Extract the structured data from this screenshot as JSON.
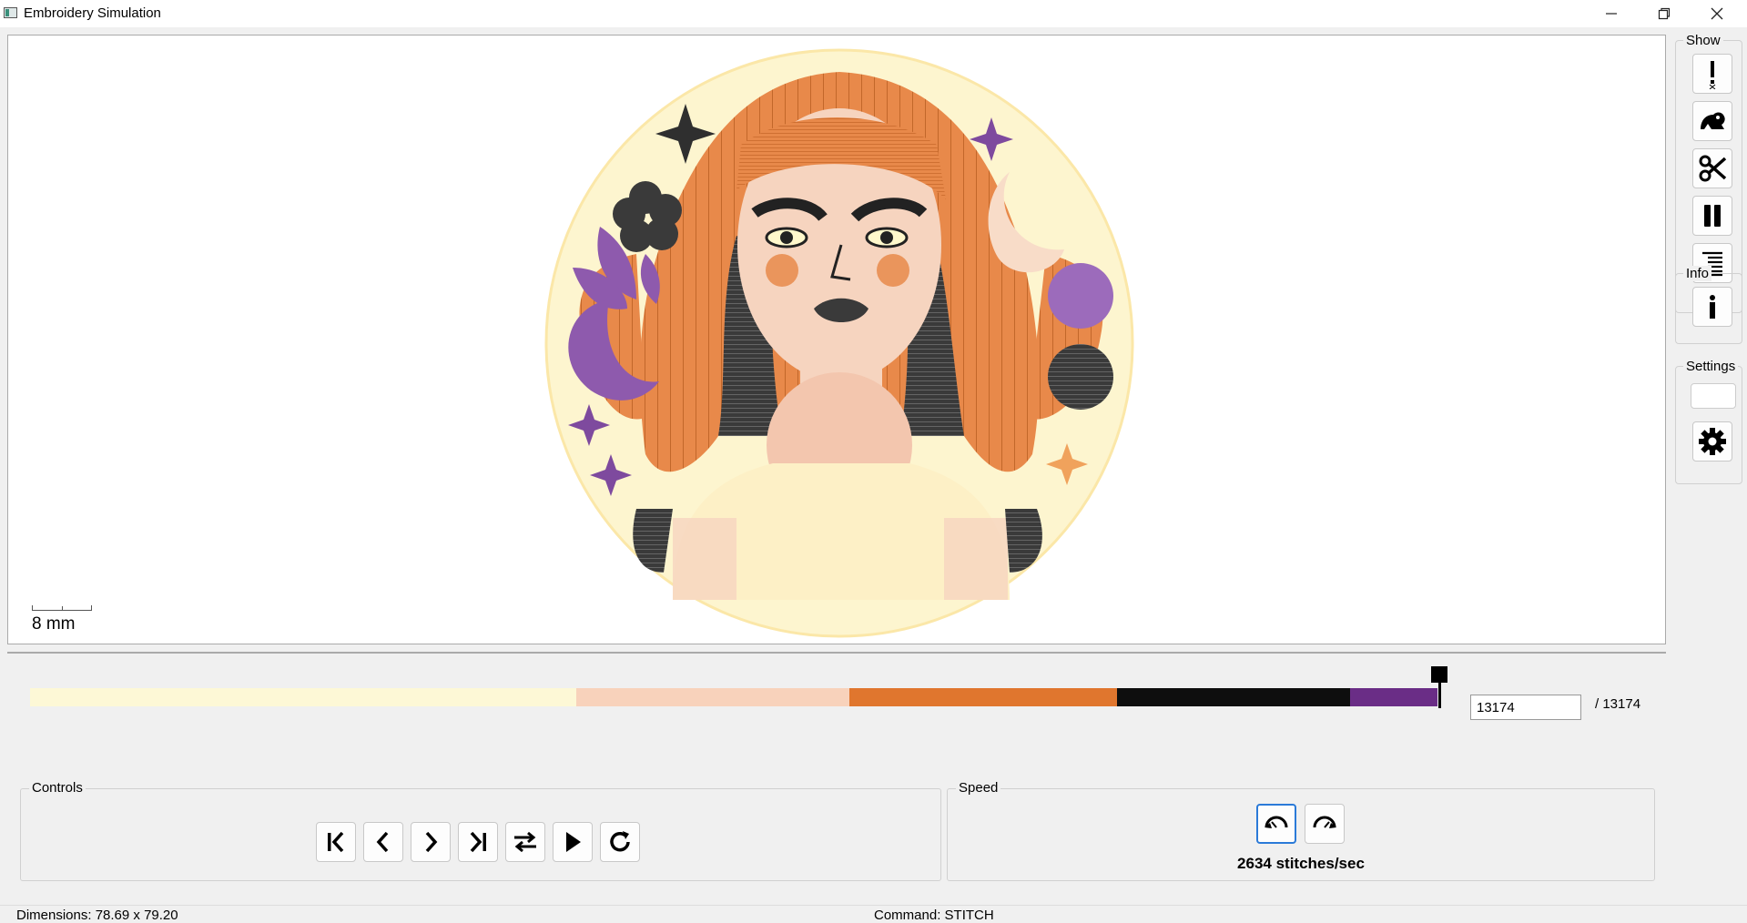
{
  "window": {
    "title": "Embroidery Simulation"
  },
  "canvas": {
    "scale_label": "8 mm"
  },
  "side_panel": {
    "show_title": "Show",
    "info_title": "Info",
    "settings_title": "Settings",
    "show_buttons": [
      "warning-icon",
      "frog-icon",
      "scissors-icon",
      "pause-icon",
      "text-lines-icon"
    ],
    "info_button": "info-icon",
    "settings_button": "gear-icon"
  },
  "timeline": {
    "current_stitch": "13174",
    "total_label": "/ 13174",
    "progress_fraction": 1.0,
    "color_blocks": [
      {
        "color": "#fdf8d6",
        "fraction": 0.388
      },
      {
        "color": "#f8d2bb",
        "fraction": 0.194
      },
      {
        "color": "#e0762e",
        "fraction": 0.19
      },
      {
        "color": "#0e0e0e",
        "fraction": 0.166
      },
      {
        "color": "#6a2d86",
        "fraction": 0.062
      }
    ]
  },
  "controls": {
    "title": "Controls",
    "buttons": [
      "skip-to-start-icon",
      "step-back-icon",
      "step-forward-icon",
      "skip-to-end-icon",
      "swap-direction-icon",
      "play-icon",
      "reload-icon"
    ]
  },
  "speed": {
    "title": "Speed",
    "value_label": "2634 stitches/sec",
    "buttons": [
      "slow-down-icon",
      "speed-up-icon"
    ]
  },
  "status_bar": {
    "dimensions": "Dimensions: 78.69 x 79.20",
    "command": "Command: STITCH"
  }
}
